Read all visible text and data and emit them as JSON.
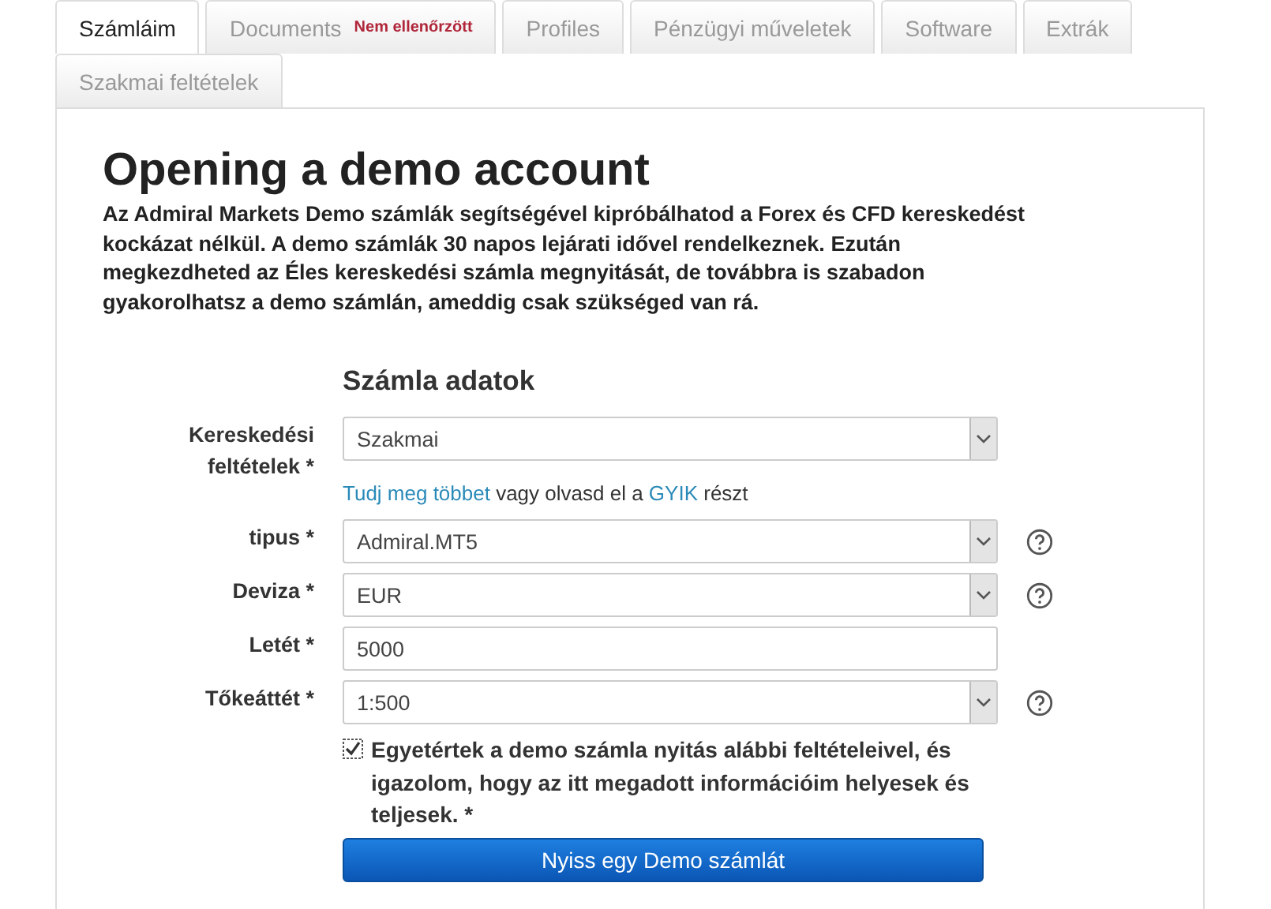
{
  "tabs": [
    {
      "label": "Számláim",
      "selected": true
    },
    {
      "label": "Documents",
      "badge": "Nem ellenőrzött",
      "selected": false
    },
    {
      "label": "Profiles",
      "selected": false
    },
    {
      "label": "Pénzügyi műveletek",
      "selected": false
    },
    {
      "label": "Software",
      "selected": false
    },
    {
      "label": "Extrák",
      "selected": false
    },
    {
      "label": "Szakmai feltételek",
      "selected": false
    }
  ],
  "heading": "Opening a demo account",
  "intro": "Az Admiral Markets Demo számlák segítségével kipróbálhatod a Forex és CFD kereskedést kockázat nélkül. A demo számlák 30 napos lejárati idővel rendelkeznek. Ezután megkezdheted az Éles kereskedési számla megnyitását, de továbbra is szabadon gyakorolhatsz a demo számlán, ameddig csak szükséged van rá.",
  "form": {
    "title": "Számla adatok",
    "fields": [
      {
        "kind": "select",
        "label": "Kereskedési feltételek *",
        "value": "Szakmai",
        "help": false,
        "info": [
          {
            "kind": "link",
            "text": "Tudj meg többet"
          },
          {
            "kind": "text",
            "text": " vagy olvasd el a "
          },
          {
            "kind": "link",
            "text": "GYIK"
          },
          {
            "kind": "text",
            "text": " részt"
          }
        ]
      },
      {
        "kind": "select",
        "label": "tipus *",
        "value": "Admiral.MT5",
        "help": true
      },
      {
        "kind": "select",
        "label": "Deviza *",
        "value": "EUR",
        "help": true
      },
      {
        "kind": "input",
        "label": "Letét *",
        "value": "5000",
        "help": false
      },
      {
        "kind": "select",
        "label": "Tőkeáttét *",
        "value": "1:500",
        "help": true
      }
    ],
    "agree": {
      "checked": true,
      "text": "Egyetértek a demo számla nyitás alábbi feltételeivel, és igazolom, hogy az itt megadott információim helyesek és teljesek. *"
    },
    "submit": "Nyiss egy Demo számlát"
  }
}
